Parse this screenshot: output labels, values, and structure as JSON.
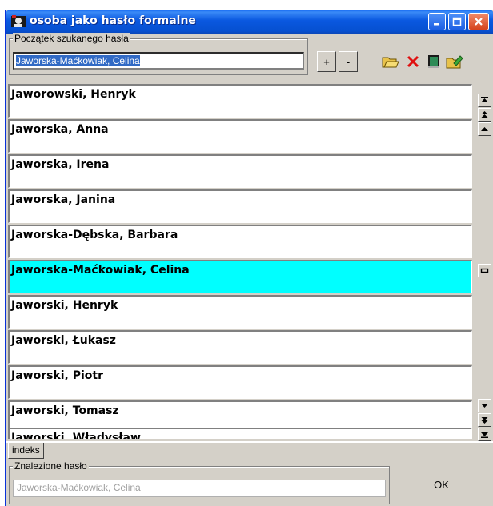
{
  "window": {
    "title": "osoba jako hasło formalne"
  },
  "search": {
    "legend": "Początek szukanego hasła",
    "value": "Jaworska-Maćkowiak, Celina"
  },
  "toolbar": {
    "plus_label": "+",
    "minus_label": "-"
  },
  "list": {
    "items": [
      {
        "label": "Jaworowski, Henryk"
      },
      {
        "label": "Jaworska, Anna"
      },
      {
        "label": "Jaworska, Irena"
      },
      {
        "label": "Jaworska, Janina"
      },
      {
        "label": "Jaworska-Dębska, Barbara"
      },
      {
        "label": "Jaworska-Maćkowiak, Celina",
        "selected": true
      },
      {
        "label": "Jaworski, Henryk"
      },
      {
        "label": "Jaworski, Łukasz"
      },
      {
        "label": "Jaworski, Piotr"
      },
      {
        "label": "Jaworski, Tomasz"
      },
      {
        "label": "Jaworski, Władysław"
      }
    ],
    "selected_color": "#00ffff"
  },
  "tabs": {
    "index_label": "indeks"
  },
  "found": {
    "legend": "Znalezione hasło",
    "value": "Jaworska-Maćkowiak, Celina"
  },
  "ok_label": "OK",
  "icons": {
    "app": "app-icon",
    "minimize": "minimize-icon",
    "maximize": "maximize-icon",
    "close": "close-icon",
    "open": "open-folder-icon",
    "delete": "delete-icon",
    "book": "book-icon",
    "edit": "edit-icon"
  }
}
